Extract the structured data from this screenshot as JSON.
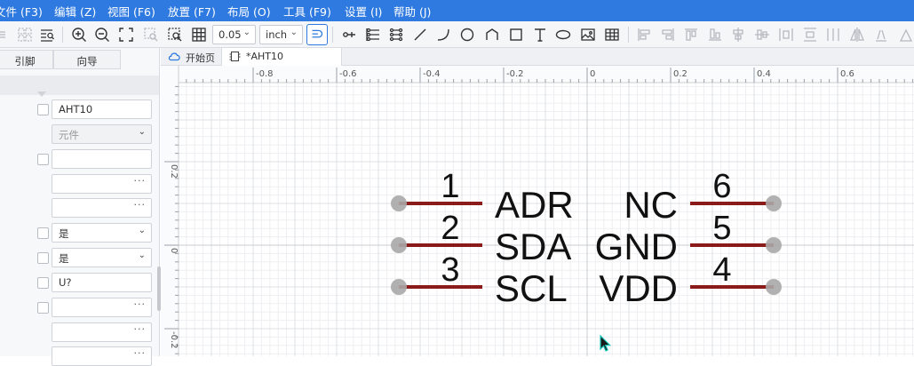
{
  "menu": {
    "items": [
      "文件 (F3)",
      "编辑 (Z)",
      "视图 (F6)",
      "放置 (F7)",
      "布局 (O)",
      "工具 (F9)",
      "设置 (I)",
      "帮助 (J)"
    ]
  },
  "toolbar": {
    "grid_value": "0.05",
    "unit_value": "inch"
  },
  "left_panel": {
    "tabs": [
      "引脚",
      "向导"
    ],
    "fields": [
      {
        "value": "AHT10",
        "kind": "text"
      },
      {
        "value": "元件",
        "kind": "select-disabled"
      },
      {
        "value": "",
        "kind": "text"
      },
      {
        "value": "",
        "kind": "more"
      },
      {
        "value": "",
        "kind": "more"
      },
      {
        "value": "是",
        "kind": "select"
      },
      {
        "value": "是",
        "kind": "select"
      },
      {
        "value": "U?",
        "kind": "text"
      },
      {
        "value": "",
        "kind": "more"
      },
      {
        "value": "",
        "kind": "more"
      },
      {
        "value": "",
        "kind": "more"
      }
    ]
  },
  "doc_tabs": [
    "开始页",
    "*AHT10"
  ],
  "ruler": {
    "x_labels": [
      "-0.8",
      "-0.6",
      "-0.4",
      "-0.2",
      "0",
      "0.2",
      "0.4",
      "0.6"
    ],
    "y_labels": [
      "0.2",
      "0",
      "-0.2"
    ]
  },
  "symbol": {
    "left_pins": [
      {
        "number": "1",
        "name": "ADR"
      },
      {
        "number": "2",
        "name": "SDA"
      },
      {
        "number": "3",
        "name": "SCL"
      }
    ],
    "right_pins": [
      {
        "number": "6",
        "name": "NC"
      },
      {
        "number": "5",
        "name": "GND"
      },
      {
        "number": "4",
        "name": "VDD"
      }
    ],
    "pin_color": "#8b1a1a",
    "pin_end_color": "#a9a9a9"
  },
  "colors": {
    "menubar": "#2f7ae0",
    "accent": "#2f7ae0"
  }
}
